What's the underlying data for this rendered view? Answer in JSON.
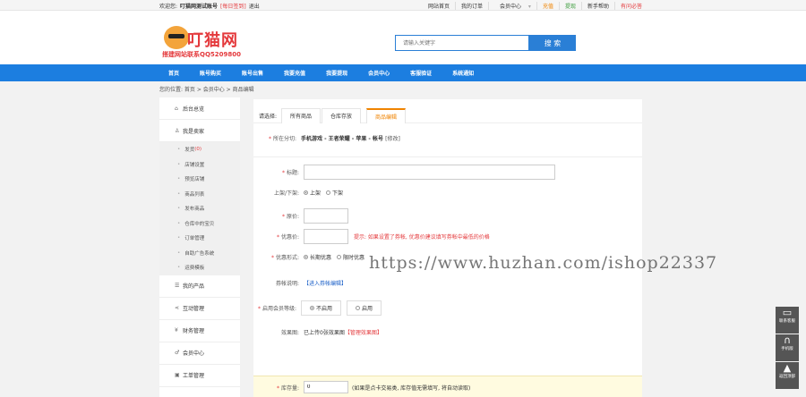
{
  "topbar": {
    "welcome": "欢迎您:",
    "user": "叮猫网测试账号",
    "signin": "[每日签到]",
    "logout": "退出",
    "links": [
      "网站首页",
      "我的订单",
      "会员中心",
      "充值",
      "提现",
      "新手帮助",
      "有问必答"
    ]
  },
  "header": {
    "brand": "叮猫网",
    "slogan": "搭建网站联系QQ5209800",
    "search_placeholder": "请输入关键字",
    "search_button": "搜 索"
  },
  "nav": [
    "首页",
    "账号购买",
    "账号出售",
    "我要充值",
    "我要提现",
    "会员中心",
    "客服验证",
    "系统通知"
  ],
  "breadcrumb": "您的位置: 首页 > 会员中心 > 商品编辑",
  "sidebar": {
    "groups_top": [
      "后台总览",
      "我是卖家"
    ],
    "seller_items": [
      "发货",
      "店铺设置",
      "预览店铺",
      "商品列表",
      "发布商品",
      "仓库中的宝贝",
      "订单管理",
      "自助广告系统",
      "运费模板"
    ],
    "ship_count": "(0)",
    "groups_bottom": [
      "我的产品",
      "互动管理",
      "财务管理",
      "会员中心",
      "工单管理"
    ]
  },
  "tabs": {
    "label": "请选择:",
    "items": [
      "所有商品",
      "仓库存放",
      "商品编辑"
    ]
  },
  "form": {
    "category_label": "所在分切:",
    "category_path": "手机游戏 - 王者荣耀 - 苹果 - 帐号",
    "category_modify": "[修改]",
    "title_label": "标题:",
    "onshelf_label": "上架/下架:",
    "onshelf_on": "上架",
    "onshelf_off": "下架",
    "orig_price_label": "原价:",
    "promo_price_label": "优惠价:",
    "promo_hint": "提示: 如果设置了券帐, 优惠价建议填写券帐中最低的价格",
    "promo_form_label": "优惠形式:",
    "promo_long": "长期优惠",
    "promo_time": "限时优惠",
    "coupon_label": "券帐说明:",
    "coupon_link": "【进入券帐编辑】",
    "member_label": "启用会员等级:",
    "member_off": "不启用",
    "member_on": "启用",
    "effect_label": "效果图:",
    "effect_text": "已上传0张效果图",
    "effect_link": "【管理效果图】",
    "stock_label": "库存量:",
    "stock_value": "0",
    "stock_hint": "(如果是点卡交易类, 库存值无需填写, 将自动读取)"
  },
  "watermark": "https://www.huzhan.com/ishop22337",
  "float": [
    "联系客服",
    "手机版",
    "返回顶部"
  ]
}
